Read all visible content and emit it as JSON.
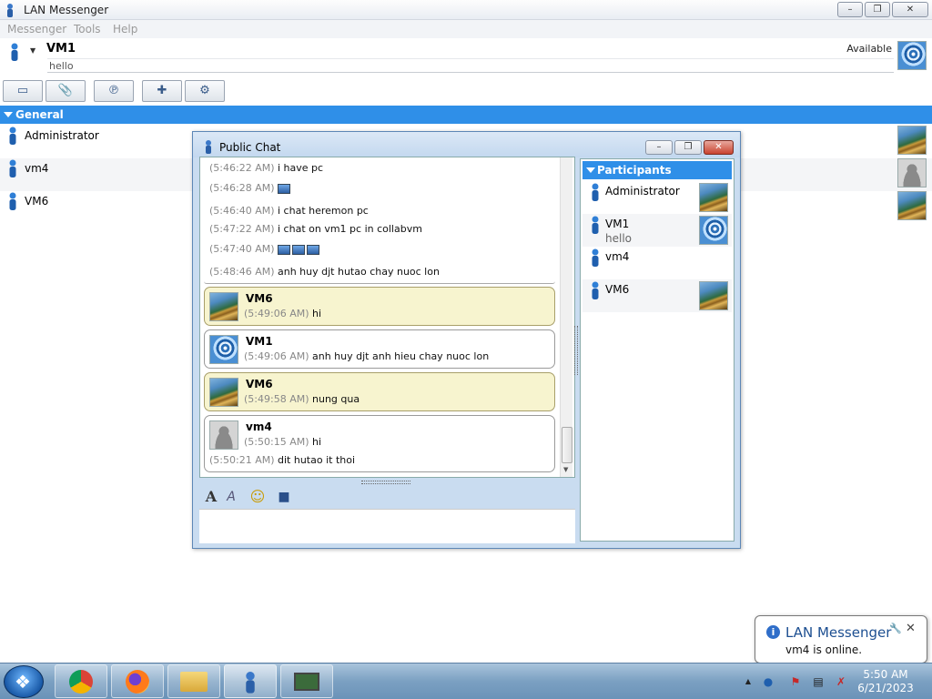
{
  "app": {
    "title": "LAN Messenger",
    "menu": [
      "Messenger",
      "Tools",
      "Help"
    ],
    "window_buttons": {
      "minimize": "–",
      "maximize": "❐",
      "close": "✕"
    }
  },
  "user": {
    "name": "VM1",
    "note": "hello",
    "status": "Available",
    "dropdown": "▼"
  },
  "toolbar": {
    "icons": [
      "chat-bubble-icon",
      "file-transfer-icon",
      "broadcast-icon",
      "add-contact-icon",
      "group-settings-icon"
    ]
  },
  "contacts": {
    "group_name": "General",
    "items": [
      {
        "name": "Administrator",
        "avatar": "steps"
      },
      {
        "name": "vm4",
        "avatar": "person"
      },
      {
        "name": "VM6",
        "avatar": "steps"
      }
    ]
  },
  "chat": {
    "title": "Public Chat",
    "history_lines": [
      {
        "time": "(5:46:22 AM)",
        "text": "i have pc",
        "icons": 0
      },
      {
        "time": "(5:46:28 AM)",
        "text": "",
        "icons": 1
      },
      {
        "time": "(5:46:40 AM)",
        "text": "i chat heremon pc",
        "icons": 0
      },
      {
        "time": "(5:47:22 AM)",
        "text": "i chat  on vm1 pc in collabvm",
        "icons": 0
      },
      {
        "time": "(5:47:40 AM)",
        "text": "",
        "icons": 3
      },
      {
        "time": "(5:48:46 AM)",
        "text": "anh huy djt hutao chay nuoc lon",
        "icons": 0
      }
    ],
    "bubbles": [
      {
        "sender": "VM6",
        "avatar": "steps",
        "style": "yellow",
        "lines": [
          {
            "time": "(5:49:06 AM)",
            "text": "hi"
          }
        ]
      },
      {
        "sender": "VM1",
        "avatar": "flower",
        "style": "white",
        "lines": [
          {
            "time": "(5:49:06 AM)",
            "text": "anh huy djt anh hieu chay nuoc lon"
          }
        ]
      },
      {
        "sender": "VM6",
        "avatar": "steps",
        "style": "yellow",
        "lines": [
          {
            "time": "(5:49:58 AM)",
            "text": "nung qua"
          }
        ]
      },
      {
        "sender": "vm4",
        "avatar": "person",
        "style": "white",
        "lines": [
          {
            "time": "(5:50:15 AM)",
            "text": "hi"
          },
          {
            "time": "(5:50:21 AM)",
            "text": "dit hutao it thoi"
          }
        ]
      }
    ],
    "edit_tools": {
      "font": "A",
      "font_size": "A",
      "smiley": "☺",
      "save": "■"
    },
    "input_value": ""
  },
  "participants": {
    "header": "Participants",
    "items": [
      {
        "name": "Administrator",
        "note": "",
        "avatar": "steps"
      },
      {
        "name": "VM1",
        "note": "hello",
        "avatar": "flower"
      },
      {
        "name": "vm4",
        "note": "",
        "avatar": ""
      },
      {
        "name": "VM6",
        "note": "",
        "avatar": "steps"
      }
    ]
  },
  "notification": {
    "title": "LAN Messenger",
    "body": "vm4 is online.",
    "close": "✕"
  },
  "taskbar": {
    "time": "5:50 AM",
    "date": "6/21/2023",
    "tray_arrow": "▲"
  },
  "colors": {
    "accent": "#2f8fe8",
    "bubble_yellow": "#f7f4cf",
    "taskbar": "#7ba0c2"
  }
}
